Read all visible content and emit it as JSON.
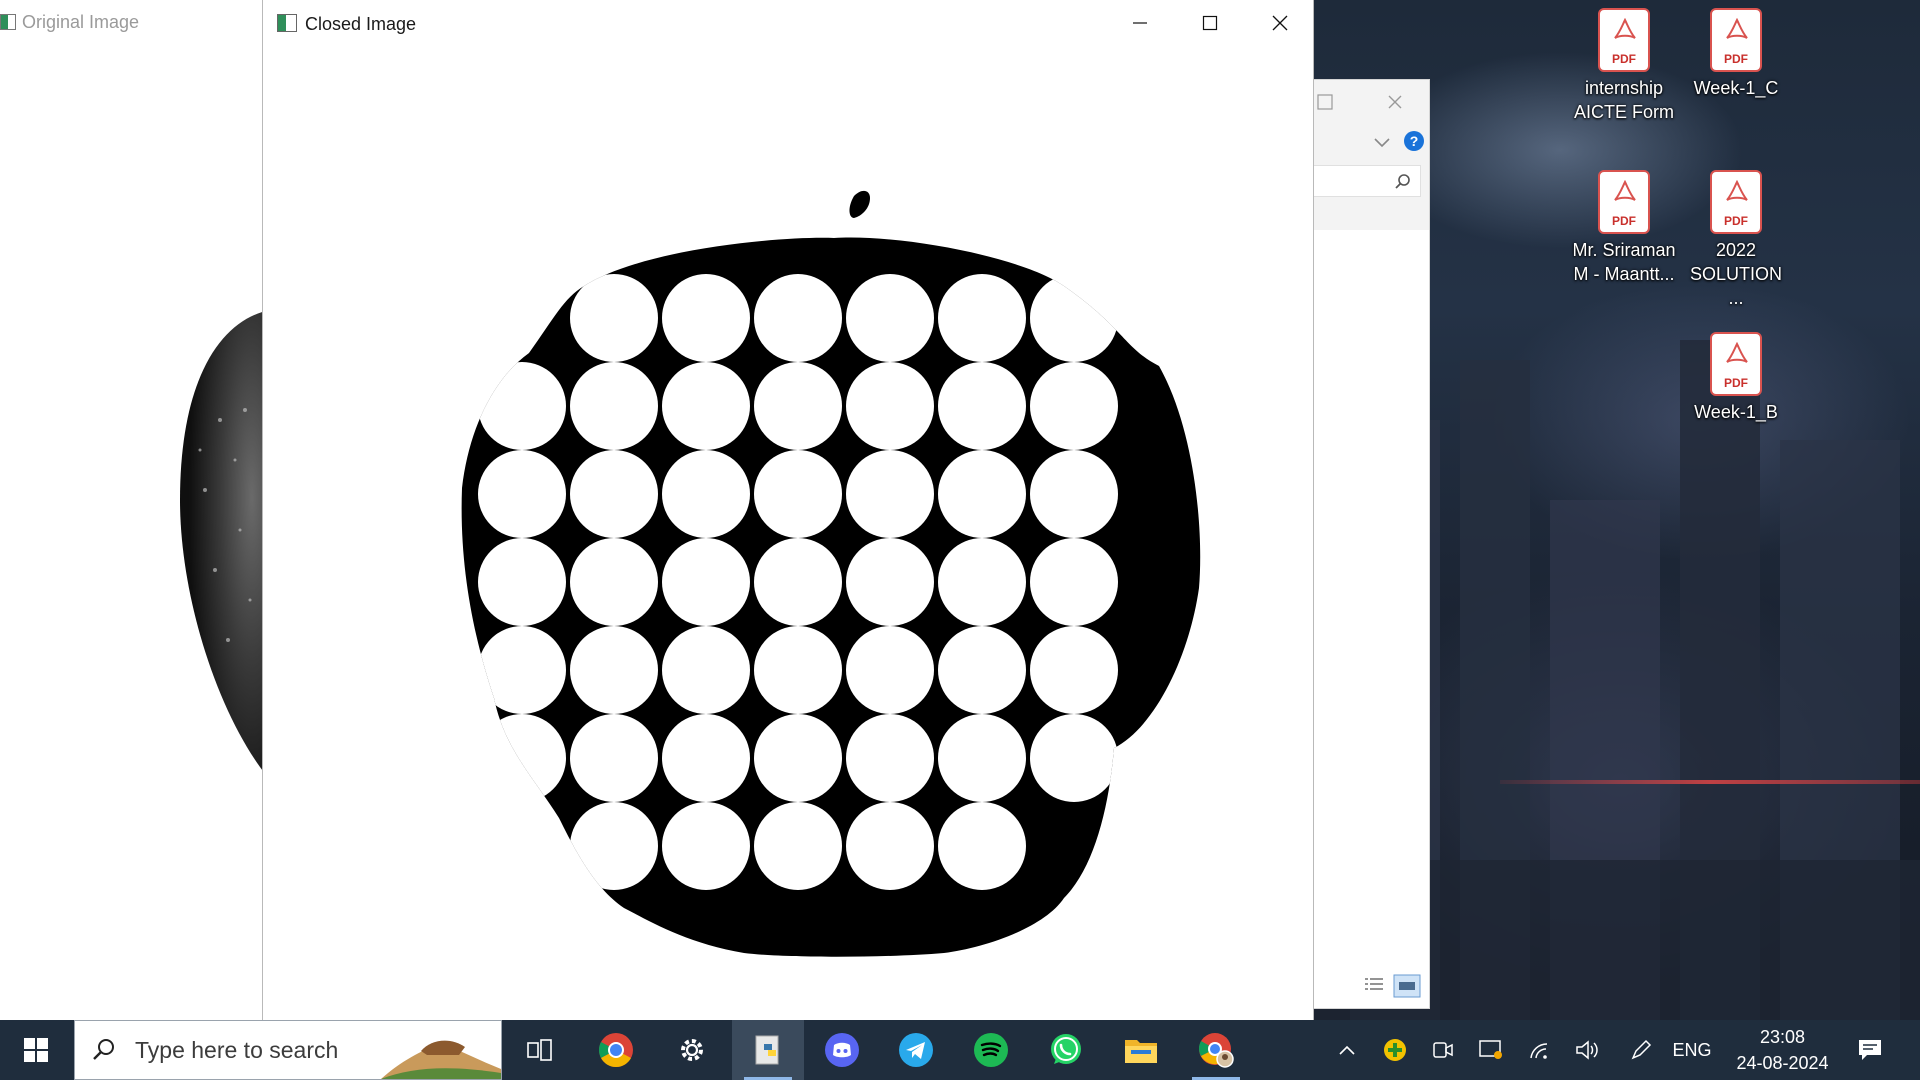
{
  "desktop": {
    "icons": [
      {
        "label_line1": "internship",
        "label_line2": "AICTE Form",
        "type": "PDF"
      },
      {
        "label_line1": "Week-1_C",
        "label_line2": "",
        "type": "PDF"
      },
      {
        "label_line1": "Mr. Sriraman",
        "label_line2": "M - Maantt...",
        "type": "PDF"
      },
      {
        "label_line1": "2022",
        "label_line2": "SOLUTION ...",
        "type": "PDF"
      },
      {
        "label_line1": "Week-1_B",
        "label_line2": "",
        "type": "PDF"
      }
    ]
  },
  "windows": {
    "original": {
      "title": "Original Image"
    },
    "closed": {
      "title": "Closed Image"
    }
  },
  "taskbar": {
    "search_placeholder": "Type here to search",
    "apps": [
      {
        "name": "task-view-icon"
      },
      {
        "name": "chrome-icon"
      },
      {
        "name": "settings-icon"
      },
      {
        "name": "python-icon",
        "active": true
      },
      {
        "name": "discord-icon"
      },
      {
        "name": "telegram-icon"
      },
      {
        "name": "spotify-icon"
      },
      {
        "name": "whatsapp-icon"
      },
      {
        "name": "file-explorer-icon"
      },
      {
        "name": "chrome-profile-icon"
      }
    ],
    "language": "ENG",
    "time": "23:08",
    "date": "24-08-2024"
  },
  "colors": {
    "taskbar_bg": "#1f2d3d",
    "pdf_red": "#d9534f",
    "help_blue": "#1a73d9"
  }
}
